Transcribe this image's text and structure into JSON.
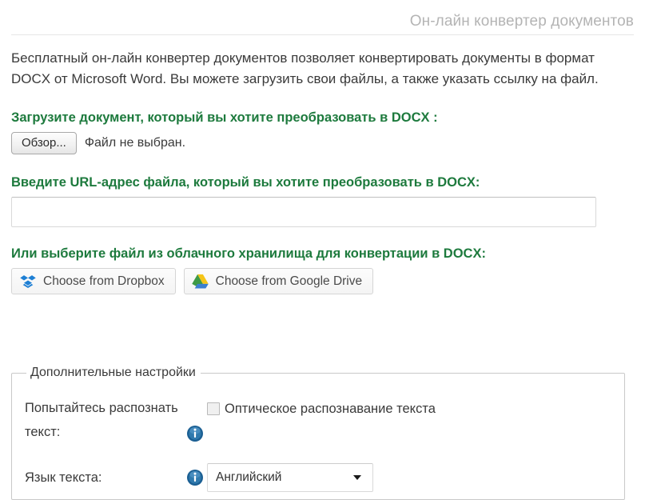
{
  "header": {
    "title": "Он-лайн конвертер документов"
  },
  "intro": {
    "paragraph": "Бесплатный он-лайн конвертер документов позволяет конвертировать документы в формат DOCX от Microsoft Word. Вы можете загрузить свои файлы, а также указать ссылку на файл."
  },
  "upload": {
    "heading": "Загрузите документ, который вы хотите преобразовать в DOCX :",
    "browse_label": "Обзор...",
    "file_status": "Файл не выбран."
  },
  "url": {
    "heading": "Введите URL-адрес файла, который вы хотите преобразовать в DOCX:",
    "value": "",
    "placeholder": ""
  },
  "cloud": {
    "heading": "Или выберите файл из облачного хранилища для конвертации в DOCX:",
    "dropbox_label": "Choose from Dropbox",
    "google_drive_label": "Choose from Google Drive",
    "dropbox_icon": "dropbox-icon",
    "google_drive_icon": "google-drive-icon"
  },
  "settings": {
    "legend": "Дополнительные настройки",
    "ocr": {
      "label": "Попытайтесь распознать текст:",
      "checkbox_label": "Оптическое распознавание текста",
      "checked": false,
      "info_icon": "info-icon"
    },
    "language": {
      "label": "Язык текста:",
      "selected": "Английский",
      "info_icon": "info-icon",
      "arrow_icon": "chevron-down-icon"
    }
  },
  "colors": {
    "heading_green": "#1d7a3d",
    "title_gray": "#b4b4b4",
    "info_blue": "#1b5f93",
    "dropbox_blue": "#1e7fd4",
    "gdrive_green": "#3e9a46",
    "gdrive_yellow": "#f5c518",
    "gdrive_blue": "#3c7fd0"
  }
}
